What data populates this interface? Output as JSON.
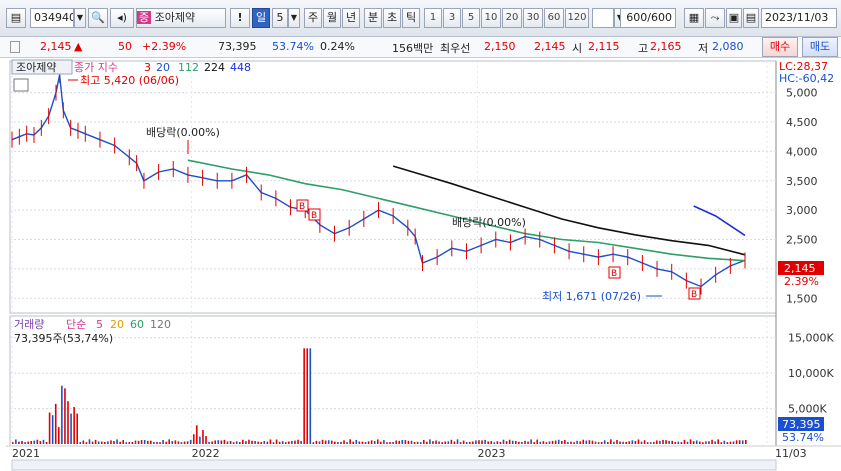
{
  "toolbar": {
    "code": "034940",
    "name_badge": "증",
    "name": "조아제약",
    "exclaim": "!",
    "period_selected": "일",
    "period_count": "5",
    "period_w": "주",
    "period_m": "월",
    "period_y": "년",
    "period_min": "분",
    "period_sec": "초",
    "period_tick": "틱",
    "nums": [
      "1",
      "3",
      "5",
      "10",
      "20",
      "30",
      "60",
      "120"
    ],
    "count": "600/600",
    "date": "2023/11/03"
  },
  "quote": {
    "price": "2,145",
    "change": "50",
    "change_pct": "+2.39%",
    "volume": "73,395",
    "vol_ratio": "53.74%",
    "turnover": "0.24%",
    "amount": "156백만",
    "bid_label": "최우선",
    "bid1": "2,150",
    "bid2": "2,145",
    "open_label": "시",
    "open": "2,115",
    "high_label": "고",
    "high": "2,165",
    "low_label": "저",
    "low": "2,080",
    "buy_label": "매수",
    "sell_label": "매도"
  },
  "price_panel": {
    "tab": "조아제약",
    "legend_label": "종가 지수",
    "ma": [
      "3",
      "20",
      "112",
      "224",
      "448"
    ],
    "lc": "LC:28,37",
    "hc": "HC:-60,42",
    "high_note": "최고 5,420 (06/06)",
    "low_note": "최저 1,671 (07/26)",
    "div1": "배당락(0.00%)",
    "div2": "배당락(0.00%)",
    "badge": "B",
    "price_tag": "2,145",
    "pct_tag": "2.39%"
  },
  "volume_panel": {
    "legend_label": "거래량",
    "legend_ma_label": "단순",
    "ma": [
      "5",
      "20",
      "60",
      "120"
    ],
    "current": "73,395주(53,74%)",
    "vol_tag": "73,395",
    "pct_tag": "53.74%"
  },
  "x_axis": [
    "2021",
    "2022",
    "2023",
    "11/03"
  ],
  "colors": {
    "up": "#e00000",
    "down": "#1a4fd0",
    "ma20": "#2e9e6a",
    "ma224": "#111111",
    "ma448": "#1e2fdc"
  },
  "chart_data": {
    "type": "line",
    "price_ticks": [
      1500,
      2000,
      2500,
      3000,
      3500,
      4000,
      4500,
      5000
    ],
    "price_tick_labels": [
      "1,500",
      "2,000",
      "2,500",
      "3,000",
      "3,500",
      "4,000",
      "4,500",
      "5,000"
    ],
    "volume_ticks": [
      5000,
      10000,
      15000
    ],
    "volume_tick_labels": [
      "5,000K",
      "10,000K",
      "15,000K"
    ],
    "ylim_price": [
      1300,
      5420
    ],
    "ylim_volume": [
      0,
      17500
    ],
    "series": [
      {
        "key": "price",
        "x": [
          0,
          0.01,
          0.02,
          0.03,
          0.04,
          0.05,
          0.06,
          0.065,
          0.07,
          0.08,
          0.09,
          0.1,
          0.12,
          0.14,
          0.16,
          0.17,
          0.18,
          0.2,
          0.22,
          0.24,
          0.26,
          0.28,
          0.3,
          0.32,
          0.34,
          0.36,
          0.38,
          0.4,
          0.42,
          0.44,
          0.46,
          0.48,
          0.5,
          0.52,
          0.54,
          0.55,
          0.56,
          0.58,
          0.6,
          0.62,
          0.64,
          0.66,
          0.68,
          0.7,
          0.72,
          0.74,
          0.76,
          0.78,
          0.8,
          0.82,
          0.84,
          0.86,
          0.88,
          0.9,
          0.92,
          0.94,
          0.96,
          0.98,
          1.0
        ],
        "y": [
          4200,
          4250,
          4300,
          4280,
          4400,
          4600,
          5000,
          5300,
          4700,
          4400,
          4350,
          4300,
          4200,
          4100,
          3900,
          3800,
          3500,
          3650,
          3700,
          3600,
          3550,
          3500,
          3500,
          3600,
          3300,
          3200,
          3050,
          3000,
          2750,
          2600,
          2700,
          2850,
          3000,
          2900,
          2700,
          2550,
          2100,
          2200,
          2350,
          2300,
          2400,
          2500,
          2450,
          2550,
          2500,
          2400,
          2300,
          2250,
          2200,
          2250,
          2200,
          2100,
          2000,
          1950,
          1800,
          1700,
          1900,
          2050,
          2145
        ]
      },
      {
        "key": "ma20",
        "x": [
          0.24,
          0.3,
          0.35,
          0.4,
          0.45,
          0.5,
          0.55,
          0.6,
          0.65,
          0.7,
          0.75,
          0.8,
          0.85,
          0.9,
          0.95,
          1.0
        ],
        "y": [
          3850,
          3700,
          3600,
          3450,
          3350,
          3200,
          3050,
          2900,
          2750,
          2600,
          2500,
          2450,
          2350,
          2250,
          2180,
          2140
        ]
      },
      {
        "key": "ma224",
        "x": [
          0.52,
          0.56,
          0.6,
          0.65,
          0.7,
          0.75,
          0.8,
          0.85,
          0.9,
          0.95,
          1.0
        ],
        "y": [
          3750,
          3600,
          3450,
          3250,
          3050,
          2850,
          2700,
          2580,
          2480,
          2400,
          2240
        ]
      },
      {
        "key": "ma448",
        "x": [
          0.93,
          0.96,
          1.0
        ],
        "y": [
          3070,
          2900,
          2570
        ]
      }
    ]
  }
}
